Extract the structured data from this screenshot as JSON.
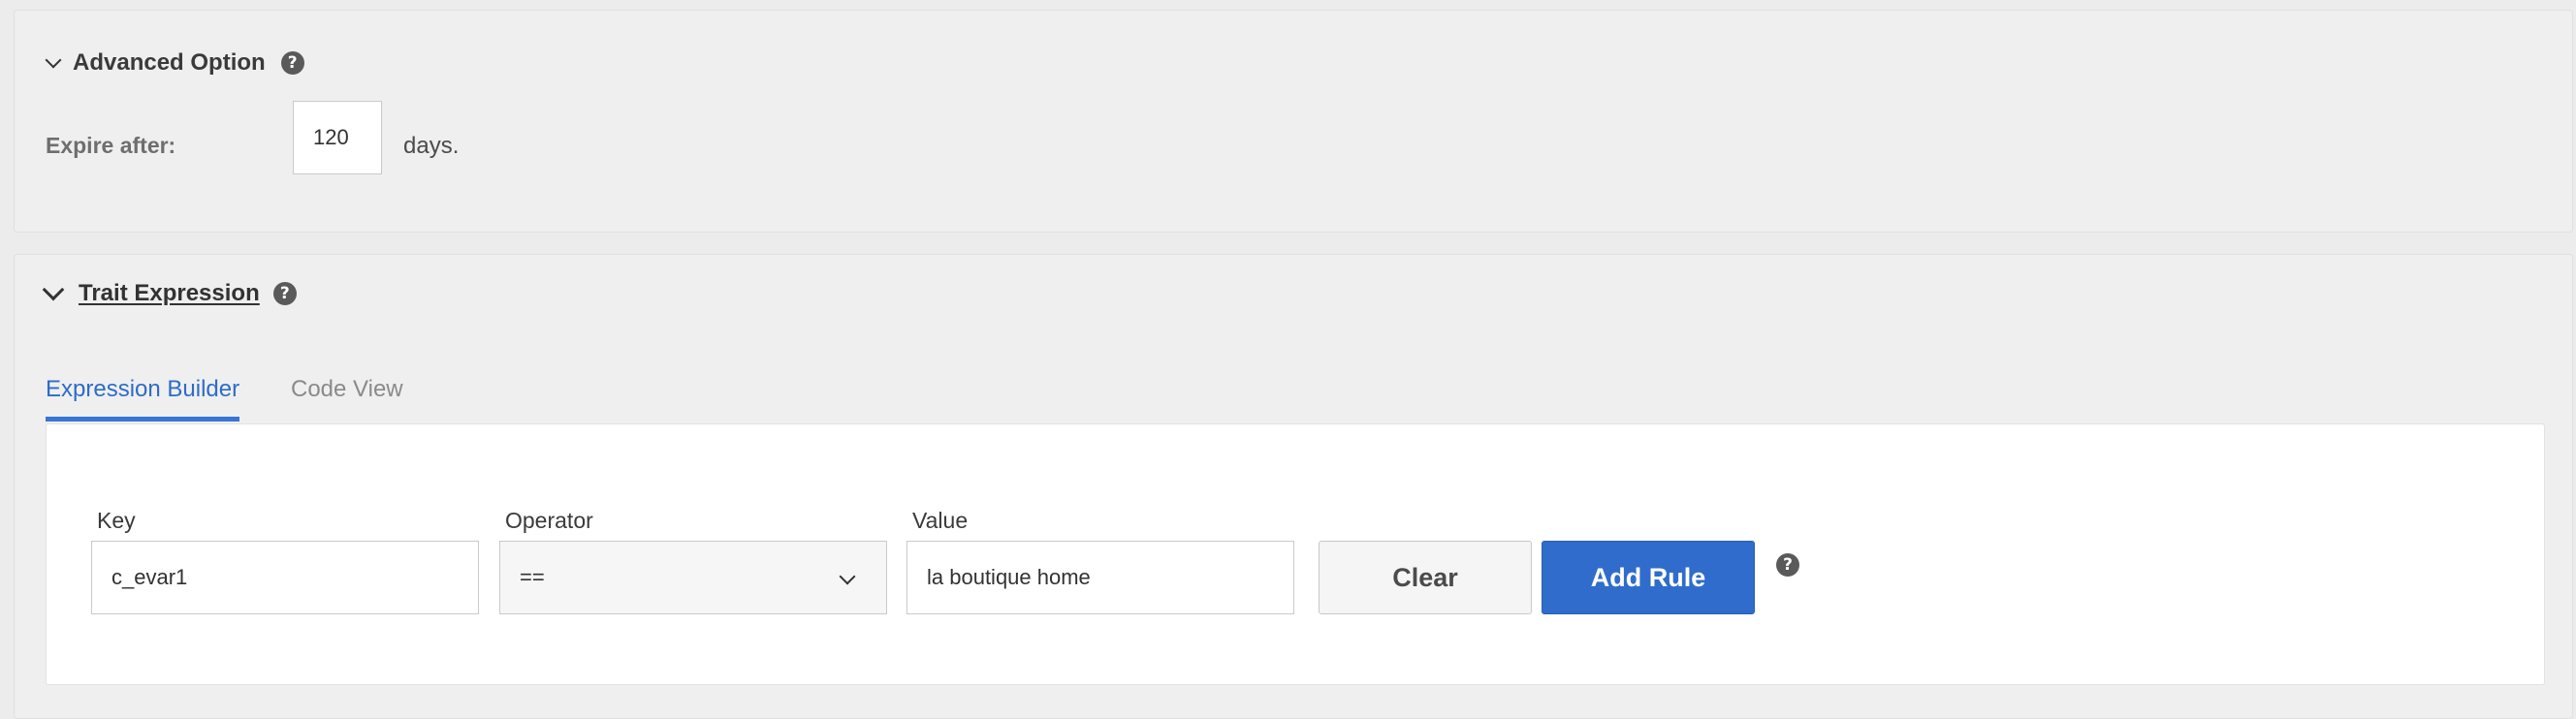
{
  "advanced": {
    "title": "Advanced Option",
    "help_icon": "question-circle-icon",
    "expire_label": "Expire after:",
    "expire_value": "120",
    "expire_suffix": "days."
  },
  "trait": {
    "title": "Trait Expression",
    "help_icon": "question-circle-icon",
    "tabs": [
      {
        "label": "Expression Builder",
        "active": true
      },
      {
        "label": "Code View",
        "active": false
      }
    ]
  },
  "rule": {
    "key_label": "Key",
    "key_value": "c_evar1",
    "operator_label": "Operator",
    "operator_value": "==",
    "value_label": "Value",
    "value_value": "la boutique home",
    "clear_label": "Clear",
    "add_label": "Add Rule"
  },
  "colors": {
    "accent": "#2f6ccb",
    "active_tab": "#2d6cc8",
    "inactive_tab": "#8a8a8a",
    "panel_bg": "#efefef"
  }
}
